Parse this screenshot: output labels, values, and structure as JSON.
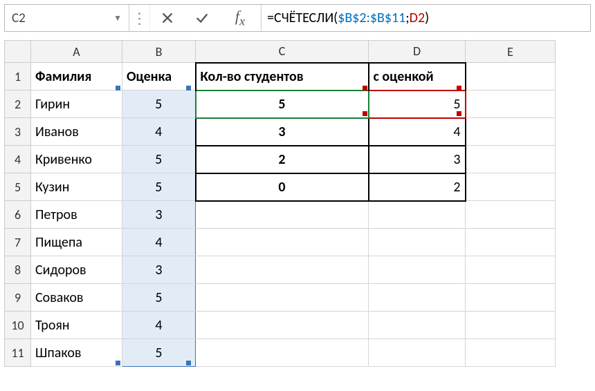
{
  "formula_bar": {
    "name_box": "C2",
    "formula_prefix": "=СЧЁТЕСЛИ(",
    "formula_ref1": "$B$2:$B$11",
    "formula_sep": ";",
    "formula_ref2": "D2",
    "formula_suffix": ")"
  },
  "columns": [
    "A",
    "B",
    "C",
    "D",
    "E"
  ],
  "row_numbers": [
    "1",
    "2",
    "3",
    "4",
    "5",
    "6",
    "7",
    "8",
    "9",
    "10",
    "11"
  ],
  "headers": {
    "A": "Фамилия",
    "B": "Оценка",
    "C": "Кол-во студентов",
    "D": "с оценкой"
  },
  "data": {
    "A": [
      "Гирин",
      "Иванов",
      "Кривенко",
      "Кузин",
      "Петров",
      "Пищепа",
      "Сидоров",
      "Соваков",
      "Троян",
      "Шпаков"
    ],
    "B": [
      "5",
      "4",
      "5",
      "5",
      "3",
      "4",
      "3",
      "5",
      "4",
      "5"
    ],
    "C": [
      "5",
      "3",
      "2",
      "0"
    ],
    "D": [
      "5",
      "4",
      "3",
      "2"
    ]
  }
}
